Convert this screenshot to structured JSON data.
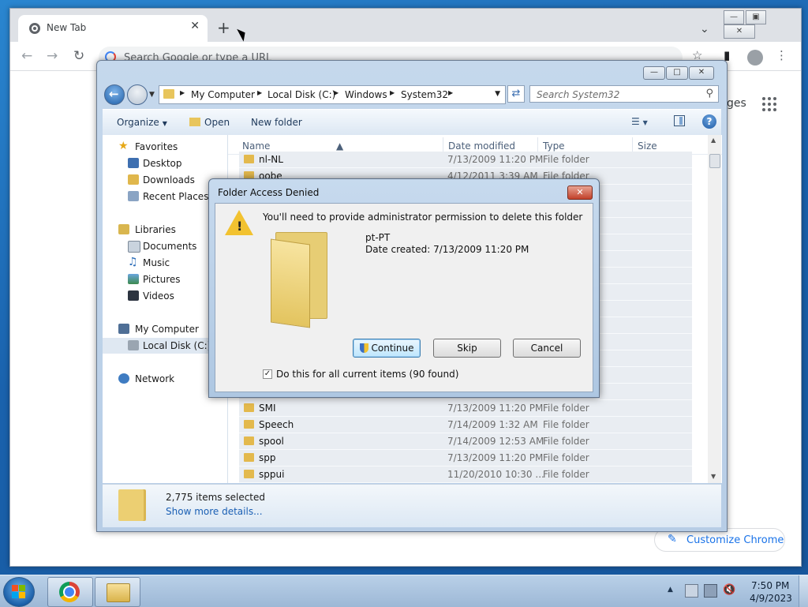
{
  "chrome": {
    "tab_title": "New Tab",
    "tab_close": "✕",
    "new_tab": "+",
    "omnibox_placeholder": "Search Google or type a URL",
    "page_right_text": "ges",
    "customize_label": "Customize Chrome",
    "chevron": "⌄"
  },
  "explorer": {
    "breadcrumb": [
      "My Computer",
      "Local Disk (C:)",
      "Windows",
      "System32"
    ],
    "search_placeholder": "Search System32",
    "toolbar": {
      "organize": "Organize",
      "open": "Open",
      "new_folder": "New folder"
    },
    "nav": {
      "favorites": "Favorites",
      "desktop": "Desktop",
      "downloads": "Downloads",
      "recent_places": "Recent Places",
      "libraries": "Libraries",
      "documents": "Documents",
      "music": "Music",
      "pictures": "Pictures",
      "videos": "Videos",
      "my_computer": "My Computer",
      "local_disk": "Local Disk (C:)",
      "network": "Network"
    },
    "columns": {
      "name": "Name",
      "date_modified": "Date modified",
      "type": "Type",
      "size": "Size"
    },
    "rows": [
      {
        "name": "nl-NL",
        "date": "7/13/2009 11:20 PM",
        "type": "File folder"
      },
      {
        "name": "oobe",
        "date": "4/12/2011 3:39 AM",
        "type": "File folder"
      },
      {
        "name": "SMI",
        "date": "7/13/2009 11:20 PM",
        "type": "File folder"
      },
      {
        "name": "Speech",
        "date": "7/14/2009 1:32 AM",
        "type": "File folder"
      },
      {
        "name": "spool",
        "date": "7/14/2009 12:53 AM",
        "type": "File folder"
      },
      {
        "name": "spp",
        "date": "7/13/2009 11:20 PM",
        "type": "File folder"
      },
      {
        "name": "sppui",
        "date": "11/20/2010 10:30 ...",
        "type": "File folder"
      }
    ],
    "details": {
      "count": "2,775 items selected",
      "more": "Show more details..."
    }
  },
  "dialog": {
    "title": "Folder Access Denied",
    "close": "✕",
    "message": "You'll need to provide administrator permission to delete this folder",
    "item_name": "pt-PT",
    "item_date": "Date created: 7/13/2009 11:20 PM",
    "continue_label": "Continue",
    "skip_label": "Skip",
    "cancel_label": "Cancel",
    "checkbox_label": "Do this for all current items (90 found)",
    "checkbox_checked": true
  },
  "taskbar": {
    "time": "7:50 PM",
    "date": "4/9/2023"
  }
}
